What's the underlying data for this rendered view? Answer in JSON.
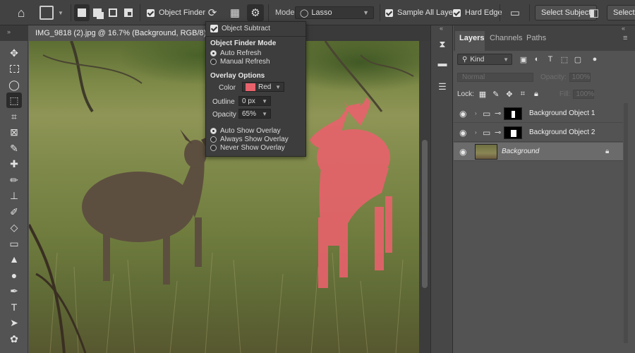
{
  "options_bar": {
    "home_icon": "home-icon",
    "object_finder_label": "Object Finder",
    "mode_label": "Mode:",
    "mode_value": "Lasso",
    "sample_all_layers_label": "Sample All Layers",
    "hard_edge_label": "Hard Edge",
    "select_subject_label": "Select Subject",
    "select_label": "Select"
  },
  "document": {
    "tab_title": "IMG_9818 (2).jpg @ 16.7% (Background, RGB/8) *"
  },
  "popover": {
    "object_subtract_label": "Object Subtract",
    "finder_mode_heading": "Object Finder Mode",
    "auto_refresh": "Auto Refresh",
    "manual_refresh": "Manual Refresh",
    "overlay_heading": "Overlay Options",
    "color_label": "Color",
    "color_value": "Red",
    "color_hex": "#e8626c",
    "outline_label": "Outline",
    "outline_value": "0 px",
    "opacity_label": "Opacity",
    "opacity_value": "65%",
    "auto_show": "Auto Show Overlay",
    "always_show": "Always Show Overlay",
    "never_show": "Never Show Overlay"
  },
  "layers_panel": {
    "tabs": [
      "Layers",
      "Channels",
      "Paths"
    ],
    "kind_label": "Kind",
    "blend_mode": "Normal",
    "opacity_label": "Opacity:",
    "opacity_value": "100%",
    "lock_label": "Lock:",
    "fill_label": "Fill:",
    "fill_value": "100%",
    "layers": [
      {
        "name": "Background Object 1"
      },
      {
        "name": "Background Object 2"
      },
      {
        "name": "Background"
      }
    ]
  }
}
